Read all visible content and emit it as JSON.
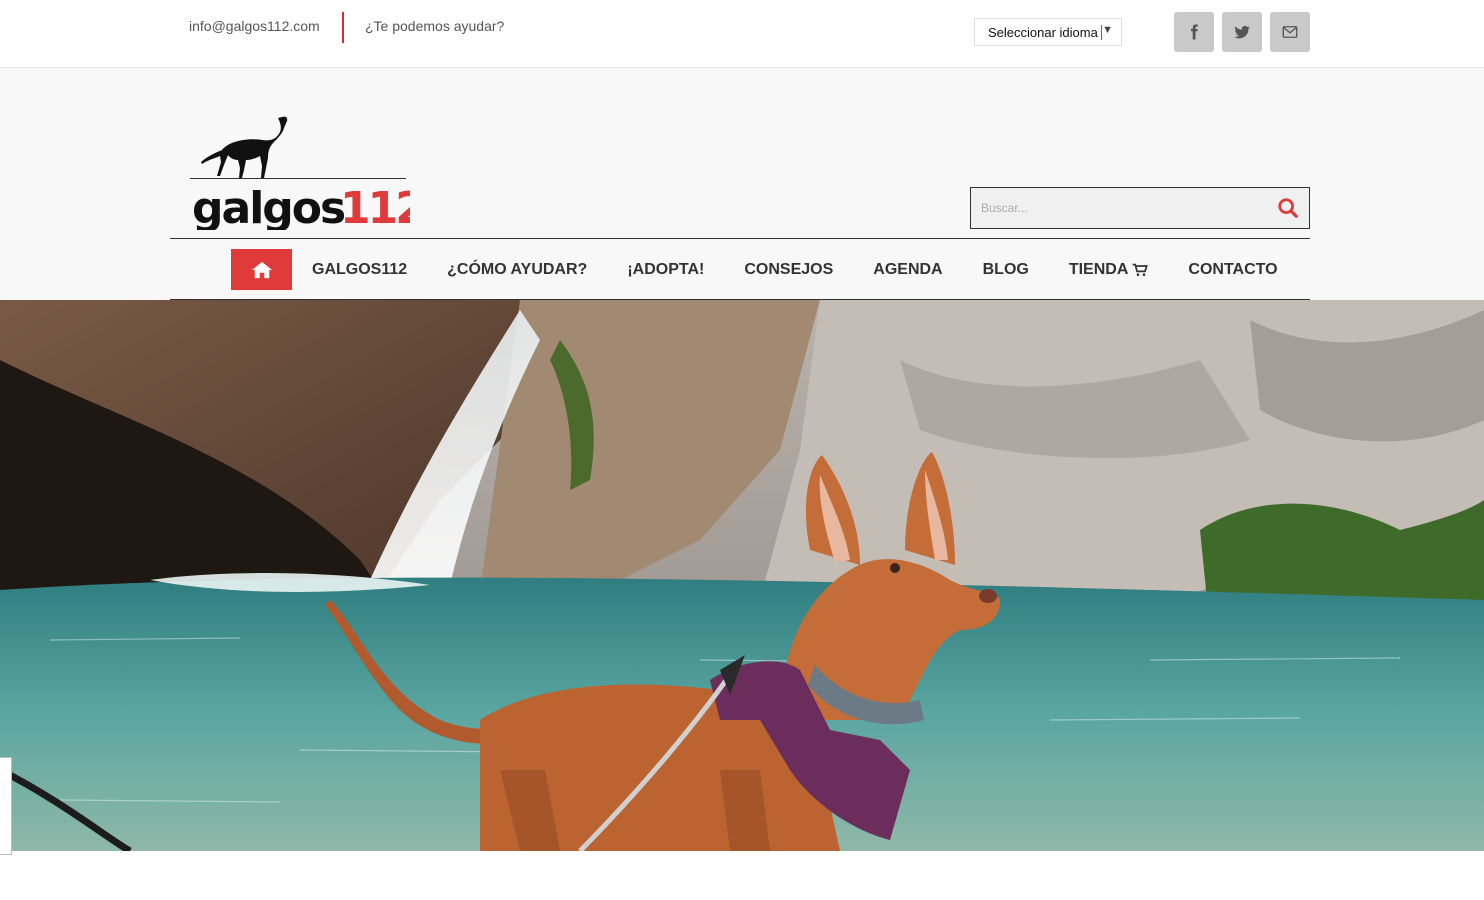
{
  "topbar": {
    "email": "info@galgos112.com",
    "help": "¿Te podemos ayudar?",
    "language_select": "Seleccionar idioma",
    "social": [
      {
        "icon": "facebook-icon"
      },
      {
        "icon": "twitter-icon"
      },
      {
        "icon": "envelope-icon"
      }
    ]
  },
  "header": {
    "logo_text": "galgos112",
    "search_placeholder": "Buscar..."
  },
  "nav": {
    "items": [
      "GALGOS112",
      "¿CÓMO AYUDAR?",
      "¡ADOPTA!",
      "CONSEJOS",
      "AGENDA",
      "BLOG",
      "TIENDA",
      "CONTACTO"
    ]
  },
  "colors": {
    "accent": "#e03a3a",
    "social_bg": "#c9c9c9",
    "header_bg": "#f8f8f8"
  }
}
